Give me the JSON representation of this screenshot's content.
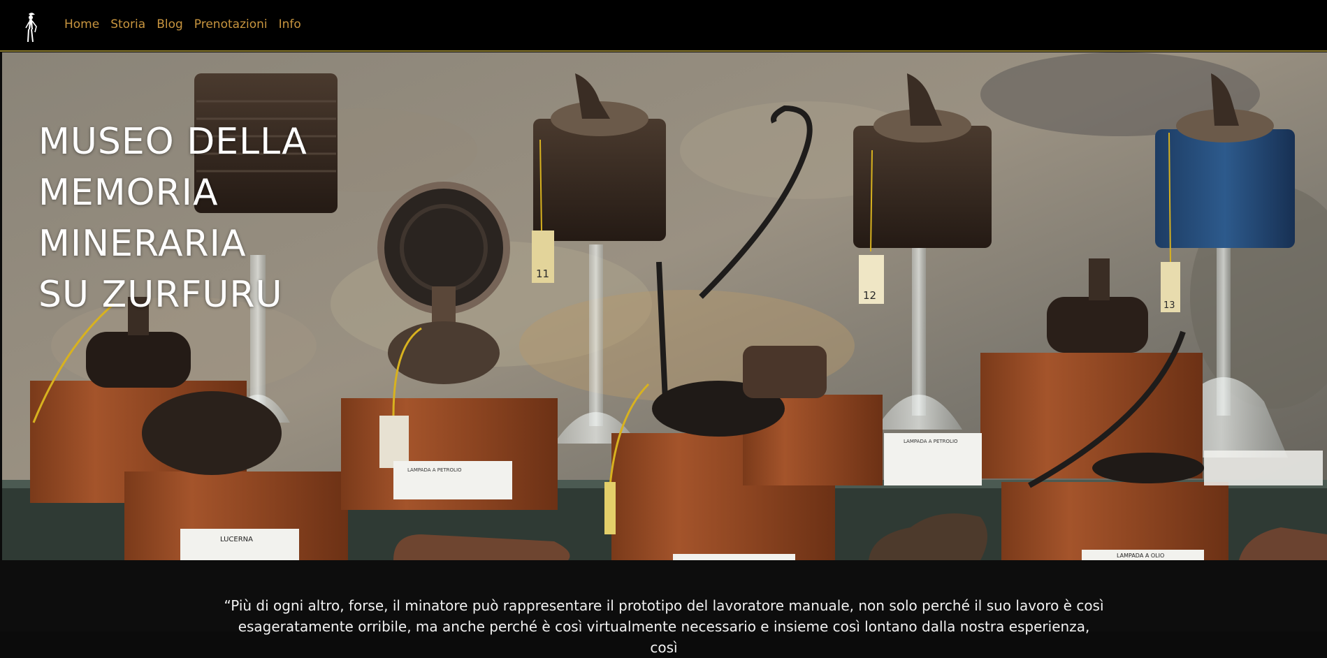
{
  "header": {
    "logo_icon": "miner-figure-icon",
    "nav": [
      {
        "label": "Home"
      },
      {
        "label": "Storia"
      },
      {
        "label": "Blog"
      },
      {
        "label": "Prenotazioni"
      },
      {
        "label": "Info"
      }
    ]
  },
  "hero": {
    "title_lines": [
      "MUSEO DELLA",
      "MEMORIA",
      "MINERARIA",
      "SU ZURFURU"
    ],
    "photo": {
      "tags": [
        "11",
        "12",
        "13"
      ],
      "labels": [
        "LUCERNA",
        "LAMPADA A PETROLIO",
        "LAMPADA A OLIO"
      ]
    }
  },
  "quote": {
    "text": "“Più di ogni altro, forse, il minatore può rappresentare il prototipo del lavoratore manuale, non solo perché il suo lavoro è così esageratamente orribile, ma anche perché è così virtualmente necessario e insieme così lontano dalla nostra esperienza, così"
  },
  "colors": {
    "nav_link": "#c8953f",
    "header_border": "#8a7a2c",
    "background": "#0d0d0d",
    "hero_text": "#ffffff"
  }
}
